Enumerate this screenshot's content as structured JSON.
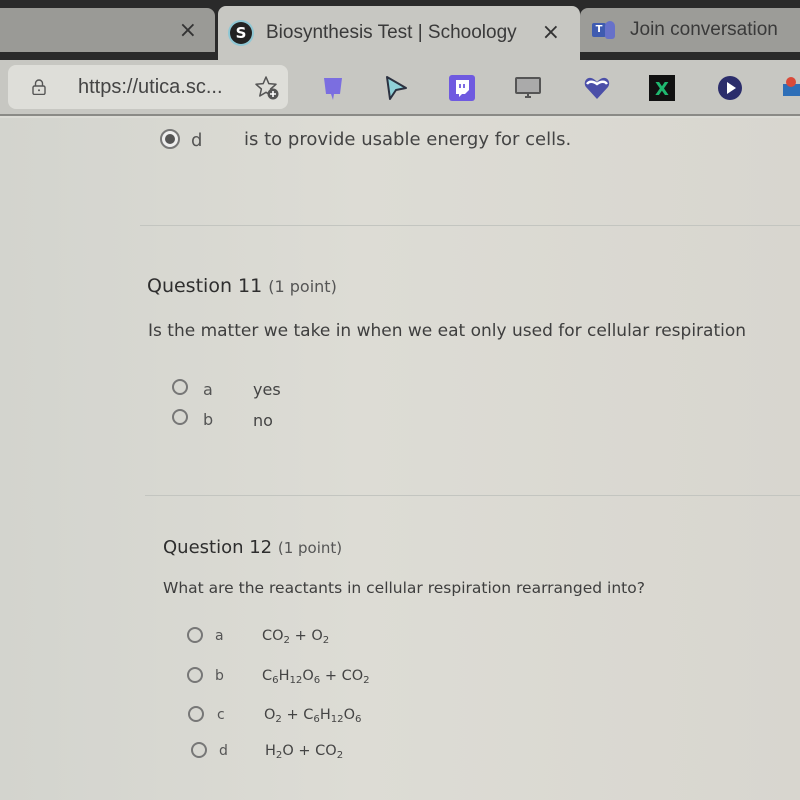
{
  "browser": {
    "tabs": [
      {
        "title": "",
        "state": "inactive",
        "close_label": "×"
      },
      {
        "title": "Biosynthesis Test | Schoology",
        "state": "active",
        "favicon": "schoology-icon",
        "favicon_glyph": "S",
        "close_label": "×"
      },
      {
        "title": "Join conversation",
        "state": "inactive",
        "favicon": "teams-icon",
        "favicon_glyph": "T"
      }
    ],
    "url": "https://utica.sc...",
    "bookmarks": [
      {
        "name": "purple-bookmark-icon",
        "color": "#7b6ee0"
      },
      {
        "name": "cursor-bookmark-icon",
        "color": "#2b3140"
      },
      {
        "name": "twitch-icon",
        "color": "#6f5ae0"
      },
      {
        "name": "monitor-icon",
        "color": "#555555"
      },
      {
        "name": "heart-icon",
        "color": "#4b4fa8"
      },
      {
        "name": "x-icon",
        "color": "#1fb86f",
        "glyph": "X"
      },
      {
        "name": "play-icon",
        "color": "#2b2d6b"
      },
      {
        "name": "partial-bookmark-icon",
        "color": "#d94a3a"
      }
    ]
  },
  "previous_question": {
    "selected_option": {
      "letter": "d",
      "text": "is to provide usable energy for cells.",
      "checked": true
    }
  },
  "questions": [
    {
      "title": "Question 11",
      "points": "(1 point)",
      "prompt": "Is the matter we take in when we eat only used for cellular respiration",
      "options": [
        {
          "letter": "a",
          "text": "yes",
          "checked": false
        },
        {
          "letter": "b",
          "text": "no",
          "checked": false
        }
      ]
    },
    {
      "title": "Question 12",
      "points": "(1 point)",
      "prompt": "What are the reactants in cellular respiration rearranged into?",
      "options": [
        {
          "letter": "a",
          "text": "CO2 + O2",
          "checked": false
        },
        {
          "letter": "b",
          "text": "C6H12O6 + CO2",
          "checked": false
        },
        {
          "letter": "c",
          "text": "O2 + C6H12O6",
          "checked": false
        },
        {
          "letter": "d",
          "text": "H2O + CO2",
          "checked": false
        }
      ]
    }
  ]
}
